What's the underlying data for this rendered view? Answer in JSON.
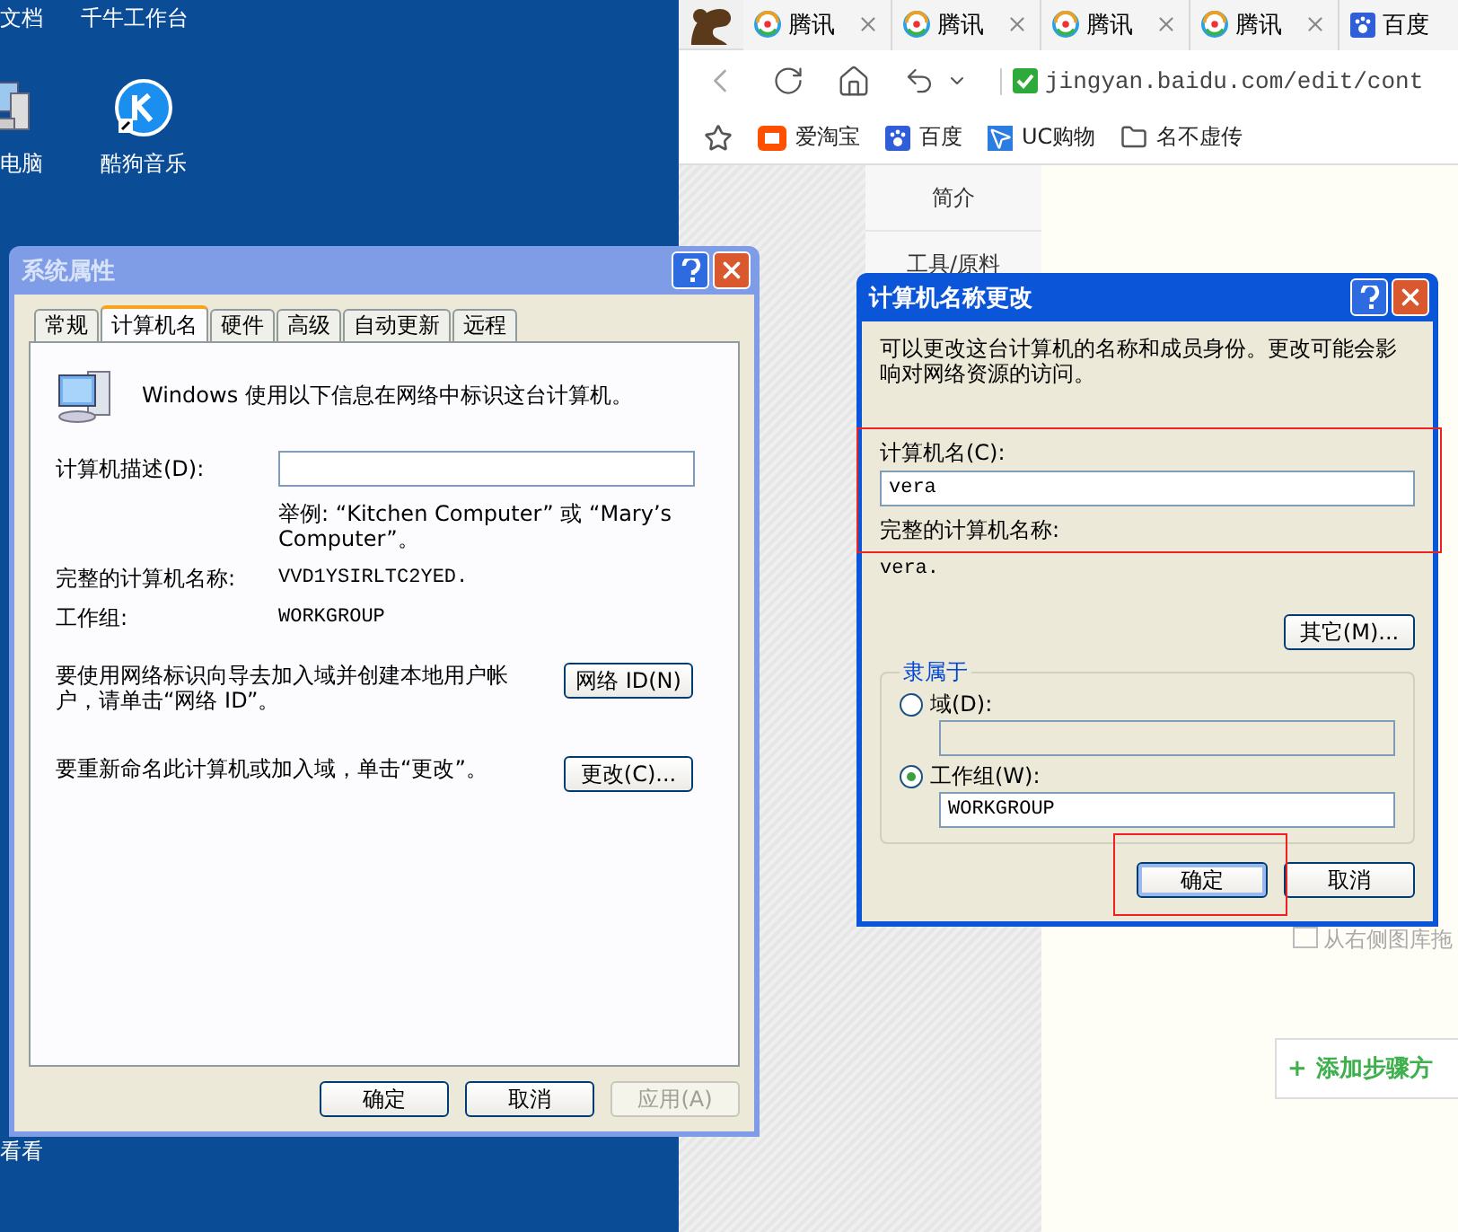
{
  "desktop": {
    "top_labels": [
      "文档",
      "千牛工作台"
    ],
    "icons": [
      {
        "kind": "computer",
        "label": "电脑"
      },
      {
        "kind": "music",
        "label": "酷狗音乐"
      }
    ],
    "bottom_label": "看看"
  },
  "browser": {
    "tabs": [
      {
        "kind": "news",
        "title": "腾讯"
      },
      {
        "kind": "news",
        "title": "腾讯"
      },
      {
        "kind": "news",
        "title": "腾讯"
      },
      {
        "kind": "news",
        "title": "腾讯"
      },
      {
        "kind": "paw",
        "title": "百度"
      }
    ],
    "address": "jingyan.baidu.com/edit/cont",
    "bookmarks": [
      {
        "kind": "shop",
        "label": "爱淘宝"
      },
      {
        "kind": "paw",
        "label": "百度"
      },
      {
        "kind": "cursor",
        "label": "UC购物"
      },
      {
        "kind": "folder",
        "label": "名不虚传"
      }
    ],
    "nav": [
      "简介",
      "工具/原料"
    ],
    "hint": "从右侧图库拖",
    "add_step": {
      "icon": "+",
      "label": "添加步骤方"
    }
  },
  "system_properties": {
    "title": "系统属性",
    "active": false,
    "tabs": [
      {
        "label": "常规",
        "selected": false
      },
      {
        "label": "计算机名",
        "selected": true
      },
      {
        "label": "硬件",
        "selected": false
      },
      {
        "label": "高级",
        "selected": false
      },
      {
        "label": "自动更新",
        "selected": false
      },
      {
        "label": "远程",
        "selected": false
      }
    ],
    "intro": "Windows 使用以下信息在网络中标识这台计算机。",
    "description_label": "计算机描述(D):",
    "example": "举例: “Kitchen Computer” 或 “Mary’s Computer”。",
    "full_name_label": "完整的计算机名称:",
    "full_name": "VVD1YSIRLTC2YED.",
    "workgroup_label": "工作组:",
    "workgroup": "WORKGROUP",
    "actions": [
      {
        "text": "要使用网络标识向导去加入域并创建本地用户帐户，请单击“网络 ID”。",
        "button": "网络 ID(N)"
      },
      {
        "text": "要重新命名此计算机或加入域，单击“更改”。",
        "button": "更改(C)..."
      }
    ],
    "buttons": [
      {
        "label": "确定",
        "disabled": false
      },
      {
        "label": "取消",
        "disabled": false
      },
      {
        "label": "应用(A)",
        "disabled": true
      }
    ]
  },
  "rename_dialog": {
    "title": "计算机名称更改",
    "active": true,
    "intro": "可以更改这台计算机的名称和成员身份。更改可能会影响对网络资源的访问。",
    "name_label": "计算机名(C):",
    "name_value": "vera",
    "full_name_label": "完整的计算机名称:",
    "full_name": "vera.",
    "more_button": "其它(M)...",
    "member_of": "隶属于",
    "options": [
      {
        "label": "域(D):",
        "checked": false
      },
      {
        "label": "工作组(W):",
        "checked": true,
        "value": "WORKGROUP"
      }
    ],
    "buttons": [
      {
        "label": "确定",
        "default": true
      },
      {
        "label": "取消",
        "default": false
      }
    ]
  }
}
